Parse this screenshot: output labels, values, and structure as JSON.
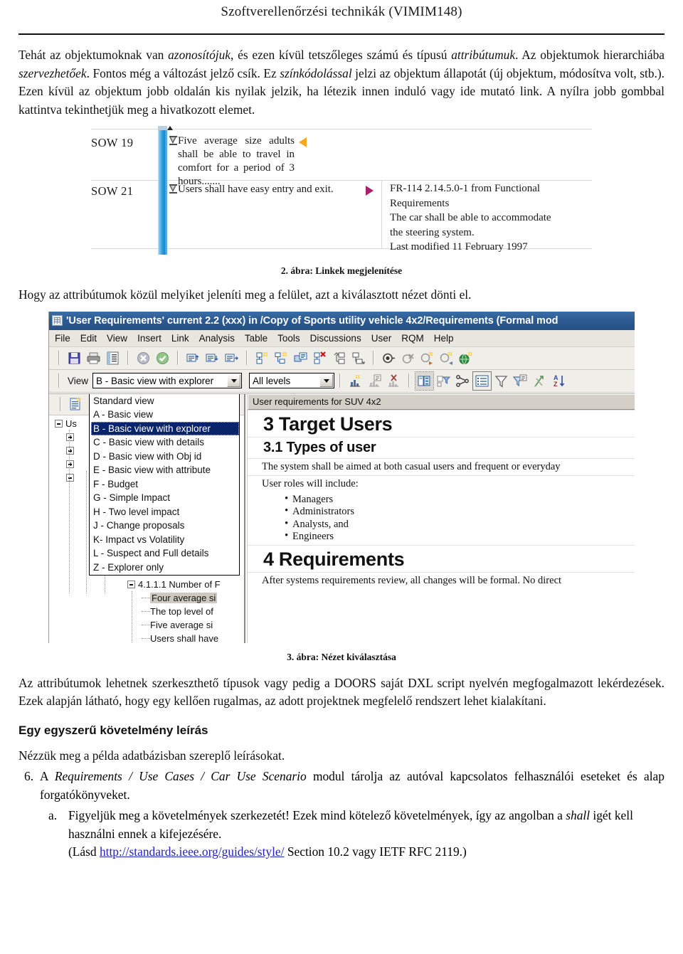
{
  "header": {
    "title": "Szoftverellenőrzési technikák (VIMIM148)"
  },
  "intro_paragraph": {
    "seg1": "Tehát az objektumoknak van ",
    "em1": "azonosítójuk",
    "seg2": ", és ezen kívül tetszőleges számú és típusú ",
    "em2": "attribútumuk",
    "seg3": ". Az objektumok hierarchiába ",
    "em3": "szervezhetőek",
    "seg4": ". Fontos még a változást jelző csík. Ez ",
    "em4": "színkódolással",
    "seg5": " jelzi az objektum állapotát (új objektum, módosítva volt, stb.). Ezen kívül az objektum jobb oldalán kis nyilak jelzik, ha létezik innen induló vagy ide mutató link. A nyílra jobb gombbal kattintva tekinthetjük meg a hivatkozott elemet."
  },
  "figure2": {
    "caption": "2. ábra: Linkek megjelenítése",
    "rows": [
      {
        "id": "SOW 19",
        "text": "Five average size adults shall be able to travel in comfort for a period of 3 hours......."
      },
      {
        "id": "SOW 21",
        "text": "Users shall have easy entry and exit."
      }
    ],
    "link_detail": "FR-114  2.14.5.0-1 from Functional\nRequirements\nThe car shall be able to accommodate\nthe steering system.\nLast modified 11 February 1997"
  },
  "middle_paragraph": "Hogy az attribútumok közül melyiket jeleníti meg a felület, azt a kiválasztott nézet dönti el.",
  "figure3": {
    "caption": "3. ábra: Nézet kiválasztása",
    "window": {
      "title": "'User Requirements' current 2.2 (xxx) in /Copy of Sports utility vehicle 4x2/Requirements (Formal mod",
      "menu": [
        "File",
        "Edit",
        "View",
        "Insert",
        "Link",
        "Analysis",
        "Table",
        "Tools",
        "Discussions",
        "User",
        "RQM",
        "Help"
      ],
      "view_label": "View",
      "view_value": "B - Basic view with explorer",
      "level_value": "All levels",
      "view_options": [
        "Standard view",
        "A - Basic view",
        "B - Basic view with explorer",
        "C - Basic view with details",
        "D - Basic view with Obj id",
        "E - Basic view with attribute",
        "F - Budget",
        "G - Simple Impact",
        "H - Two level impact",
        "J - Change proposals",
        "K- Impact vs Volatility",
        "L - Suspect and Full details",
        "Z - Explorer only"
      ],
      "selected_option": "B - Basic view with explorer",
      "tree": [
        {
          "label": "Us",
          "marker": "minus",
          "indent": 0
        },
        {
          "label": "",
          "marker": "plus",
          "indent": 1
        },
        {
          "label": "",
          "marker": "plus",
          "indent": 1
        },
        {
          "label": "",
          "marker": "plus",
          "indent": 1
        },
        {
          "label": "",
          "marker": "minus",
          "indent": 1
        }
      ],
      "tree_lower": [
        {
          "label": "4.1.1.1 Number of F",
          "marker": "minus",
          "indent": 2,
          "selected": false
        },
        {
          "label": "Four average si",
          "marker": "none",
          "indent": 3,
          "selected": true
        },
        {
          "label": "The top level of",
          "marker": "none",
          "indent": 3,
          "selected": false
        },
        {
          "label": "Five average si",
          "marker": "none",
          "indent": 3,
          "selected": false
        },
        {
          "label": "Users shall have",
          "marker": "none",
          "indent": 3,
          "selected": false
        }
      ],
      "doc": {
        "column_header": "User requirements for SUV 4x2",
        "h1": "3 Target Users",
        "h2": "3.1 Types of user",
        "p1": "The system shall be aimed at both casual users and frequent or everyday",
        "p2": "User roles will include:",
        "bullets": [
          "Managers",
          "Administrators",
          "Analysts, and",
          "Engineers"
        ],
        "h3": "4 Requirements",
        "p3": "After systems requirements review, all changes will be formal. No direct"
      }
    }
  },
  "after_fig3_paragraph": "Az attribútumok lehetnek szerkeszthető típusok vagy pedig a DOORS saját DXL script nyelvén megfogalmazott lekérdezések. Ezek alapján látható, hogy egy kellően rugalmas, az adott projektnek megfelelő rendszert lehet kialakítani.",
  "section": {
    "heading": "Egy egyszerű követelmény leírás",
    "lead": "Nézzük meg a példa adatbázisban szereplő leírásokat."
  },
  "list": {
    "item6": {
      "marker": "6.",
      "pre": "A ",
      "em": "Requirements / Use Cases / Car Use Scenario",
      "post": " modul tárolja az autóval kapcsolatos felhasználói eseteket és alap forgatókönyveket."
    },
    "item_a": {
      "marker": "a.",
      "seg1": "Figyeljük meg a követelmények szerkezetét! Ezek mind kötelező követelmények, így az angolban a ",
      "em1": "shall",
      "seg2": " igét kell használni ennek a kifejezésére.",
      "seg3": "(Lásd ",
      "link": "http://standards.ieee.org/guides/style/",
      "seg4": " Section 10.2 vagy IETF RFC 2119.)"
    }
  },
  "colors": {
    "titlebar": "#2c5a92",
    "dropdown_selection": "#0a246a",
    "changebar": "#2e9fe0",
    "arrow_in": "#f5a623",
    "arrow_out": "#a8216b",
    "link": "#2222bb"
  }
}
